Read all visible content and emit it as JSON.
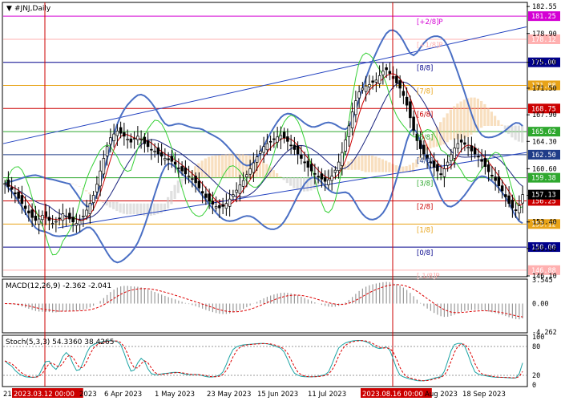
{
  "chart_data": [
    {
      "type": "candlestick",
      "symbol_label": "#JNJ,Daily",
      "ylim": [
        146.1,
        183.0
      ],
      "price_ticks": [
        "182.55",
        "178.90",
        "175.00",
        "171.50",
        "167.90",
        "164.30",
        "160.60",
        "157.00",
        "153.40",
        "149.80",
        "146.10"
      ],
      "x_labels": [
        "2023.03.12 00:00",
        "2023",
        "6 Apr 2023",
        "1 May 2023",
        "23 May 2023",
        "15 Jun 2023",
        "11 Jul 2023",
        "2023.08.16 00:00",
        "Aug 2023",
        "18 Sep 2023"
      ],
      "left_edge_label": "21",
      "murrey_levels": [
        {
          "label": "[+2/8]P",
          "price": 181.25,
          "tag": "181.25",
          "color": "#d400d4"
        },
        {
          "label": "[+1/8]P",
          "price": 178.12,
          "tag": "178.12",
          "color": "#ffb0b0"
        },
        {
          "label": "[8/8]",
          "price": 175.0,
          "tag": "175.00",
          "color": "#00008b"
        },
        {
          "label": "[7/8]",
          "price": 171.88,
          "tag": "171.88",
          "color": "#e8a317"
        },
        {
          "label": "[6/8]",
          "price": 168.75,
          "tag": "168.75",
          "color": "#cc0000"
        },
        {
          "label": "[5/8]",
          "price": 165.62,
          "tag": "165.62",
          "color": "#2ea82e"
        },
        {
          "label": "[4/8]",
          "price": 162.5,
          "tag": "162.50",
          "color": "#1f3c88"
        },
        {
          "label": "[3/8]",
          "price": 159.38,
          "tag": "159.38",
          "color": "#2ea82e"
        },
        {
          "label": "[2/8]",
          "price": 156.25,
          "tag": "156.25",
          "color": "#cc0000"
        },
        {
          "label": "[1/8]",
          "price": 153.12,
          "tag": "153.12",
          "color": "#e8a317"
        },
        {
          "label": "[0/8]",
          "price": 150.0,
          "tag": "150.00",
          "color": "#00008b"
        },
        {
          "label": "[-1/8]P",
          "price": 146.88,
          "tag": "146.88",
          "color": "#ffb0b0"
        }
      ],
      "current_price_tag": "157.13",
      "closes": [
        158.6,
        158.2,
        157.8,
        157.2,
        156.6,
        155.9,
        155.2,
        154.6,
        154.0,
        153.6,
        153.8,
        154.3,
        154.1,
        153.6,
        153.2,
        153.5,
        153.9,
        154.5,
        154.2,
        153.8,
        153.4,
        153.2,
        153.6,
        154.2,
        155.0,
        155.9,
        157.0,
        158.5,
        160.3,
        162.0,
        163.6,
        164.8,
        165.3,
        165.7,
        165.4,
        165.0,
        164.6,
        164.2,
        164.7,
        165.0,
        164.6,
        164.0,
        163.6,
        163.2,
        163.0,
        162.6,
        162.3,
        162.0,
        161.8,
        161.6,
        161.2,
        160.7,
        160.3,
        159.9,
        159.6,
        159.2,
        158.7,
        158.0,
        157.3,
        156.7,
        156.2,
        155.8,
        155.5,
        155.3,
        155.5,
        155.9,
        156.5,
        157.1,
        157.7,
        158.4,
        159.0,
        159.8,
        160.6,
        161.4,
        162.2,
        163.0,
        163.6,
        164.0,
        164.3,
        164.6,
        164.9,
        165.1,
        164.8,
        164.3,
        163.8,
        163.2,
        162.6,
        162.0,
        161.4,
        160.8,
        160.3,
        159.9,
        159.5,
        159.2,
        158.9,
        159.1,
        159.6,
        160.4,
        161.5,
        162.8,
        164.5,
        166.4,
        168.3,
        169.8,
        171.0,
        171.5,
        171.8,
        172.0,
        172.3,
        172.6,
        173.2,
        173.8,
        174.0,
        173.5,
        172.8,
        172.2,
        171.5,
        170.5,
        169.2,
        167.5,
        165.8,
        164.4,
        163.3,
        162.6,
        162.0,
        161.4,
        160.8,
        160.3,
        159.8,
        160.6,
        161.5,
        162.5,
        163.4,
        164.0,
        164.2,
        163.9,
        163.5,
        163.0,
        162.6,
        162.2,
        161.6,
        160.9,
        160.2,
        159.6,
        159.0,
        158.3,
        157.6,
        156.8,
        155.9,
        155.3,
        155.0,
        155.6,
        157.1
      ],
      "macd_label": "MACD(12,26,9) -2.362 -2.041",
      "macd_ylim": [
        -4.262,
        3.545
      ],
      "macd_ticks": [
        "3.545",
        "0.00",
        "-4.262"
      ],
      "stoch_label": "Stoch(5,3,3) 54.3360 38.4265",
      "stoch_ticks": [
        "100",
        "80",
        "20",
        "0"
      ]
    }
  ]
}
